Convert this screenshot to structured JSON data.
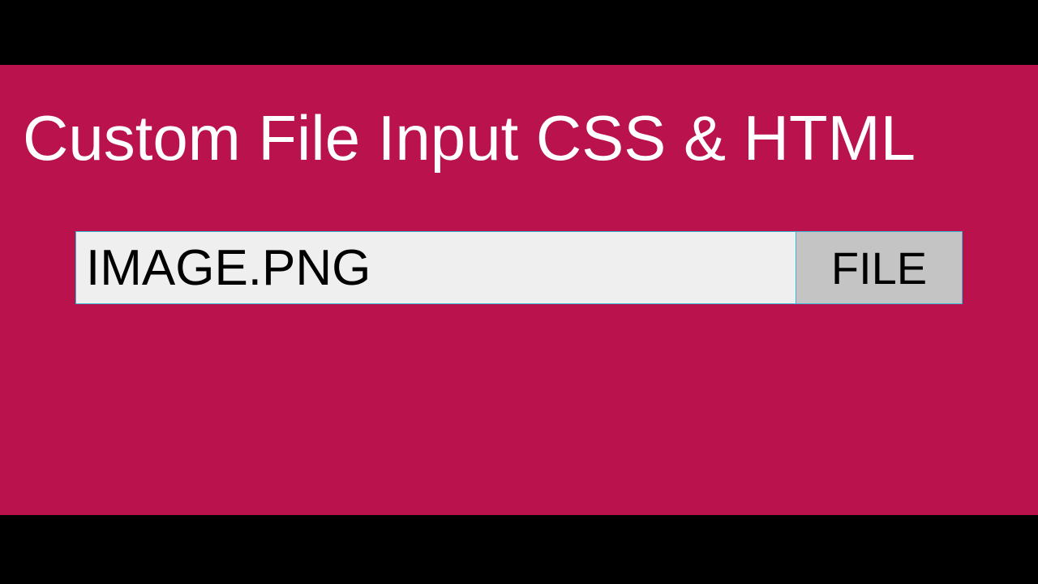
{
  "header": {
    "title": "Custom File Input CSS & HTML"
  },
  "fileInput": {
    "fileName": "IMAGE.PNG",
    "buttonLabel": "FILE"
  },
  "colors": {
    "background": "#b9124d",
    "letterbox": "#000000",
    "inputBg": "#efefef",
    "buttonBg": "#c4c4c4",
    "border": "#39b5d8"
  }
}
